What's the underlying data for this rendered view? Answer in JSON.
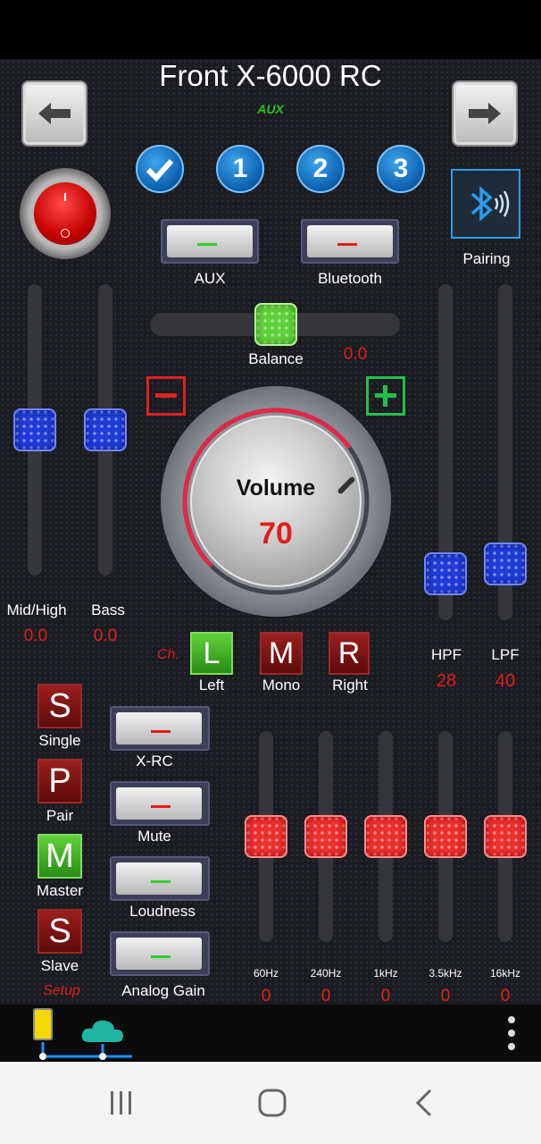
{
  "header": {
    "title": "Front X-6000 RC",
    "source": "AUX"
  },
  "presets": [
    {
      "label": "",
      "kind": "check"
    },
    {
      "label": "1"
    },
    {
      "label": "2"
    },
    {
      "label": "3"
    }
  ],
  "inputs": [
    {
      "label": "AUX",
      "active": true
    },
    {
      "label": "Bluetooth",
      "active": false
    }
  ],
  "pairing_label": "Pairing",
  "balance": {
    "label": "Balance",
    "value": "0.0"
  },
  "volume": {
    "label": "Volume",
    "value": "70",
    "level": 0.7
  },
  "crossover_left": [
    {
      "label": "Mid/High",
      "value": "0.0"
    },
    {
      "label": "Bass",
      "value": "0.0"
    }
  ],
  "filters": [
    {
      "label": "HPF",
      "value": "28"
    },
    {
      "label": "LPF",
      "value": "40"
    }
  ],
  "channel": {
    "label": "Ch.",
    "buttons": [
      {
        "letter": "L",
        "label": "Left",
        "active": true
      },
      {
        "letter": "M",
        "label": "Mono",
        "active": false
      },
      {
        "letter": "R",
        "label": "Right",
        "active": false
      }
    ]
  },
  "modes": [
    {
      "letter": "S",
      "label": "Single",
      "active": false
    },
    {
      "letter": "P",
      "label": "Pair",
      "active": false
    },
    {
      "letter": "M",
      "label": "Master",
      "active": true
    },
    {
      "letter": "S",
      "label": "Slave",
      "active": false
    }
  ],
  "setup_label": "Setup",
  "toggles": [
    {
      "label": "X-RC",
      "on": false
    },
    {
      "label": "Mute",
      "on": false
    },
    {
      "label": "Loudness",
      "on": true
    },
    {
      "label": "Analog Gain",
      "on": true
    }
  ],
  "eq": [
    {
      "freq": "60Hz",
      "value": "0"
    },
    {
      "freq": "240Hz",
      "value": "0"
    },
    {
      "freq": "1kHz",
      "value": "0"
    },
    {
      "freq": "3.5kHz",
      "value": "0"
    },
    {
      "freq": "16kHz",
      "value": "0"
    }
  ],
  "colors": {
    "accent_red": "#e31d1d",
    "on_green": "#2fd12f",
    "off_red": "#e31d1d",
    "panel": "#1a1c21"
  },
  "icons": {
    "back": "arrow-left-icon",
    "forward": "arrow-right-icon",
    "power": "power-icon",
    "bluetooth": "bluetooth-icon",
    "minus": "minus-icon",
    "plus": "plus-icon",
    "device": "phone-icon",
    "cloud": "cloud-icon",
    "menu": "more-vert-icon"
  }
}
